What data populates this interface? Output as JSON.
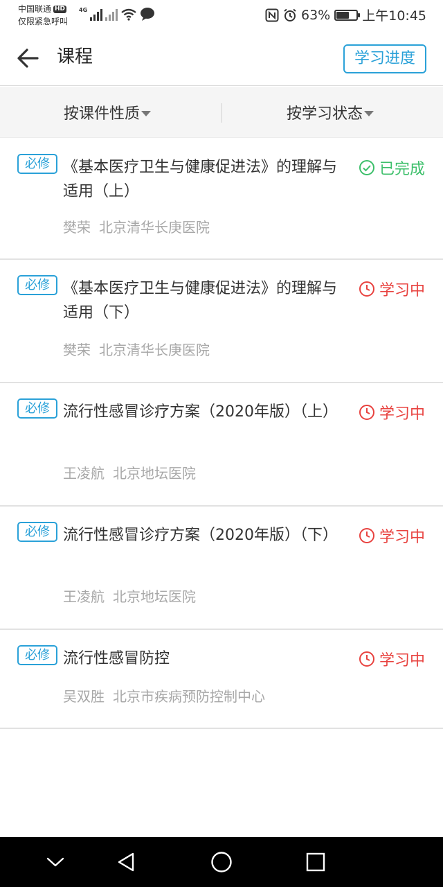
{
  "status_bar": {
    "carrier": "中国联通",
    "hd_label": "HD",
    "emergency_text": "仅限紧急呼叫",
    "network_label": "4G",
    "battery_percent": "63%",
    "battery_level": 0.63,
    "time": "上午10:45"
  },
  "header": {
    "title": "课程",
    "progress_button": "学习进度"
  },
  "filters": {
    "by_type": "按课件性质",
    "by_status": "按学习状态"
  },
  "courses": [
    {
      "badge": "必修",
      "title": "《基本医疗卫生与健康促进法》的理解与适用（上）",
      "lecturer": "樊荣",
      "institution": "北京清华长庚医院",
      "status": "已完成",
      "status_icon": "check-circle-icon"
    },
    {
      "badge": "必修",
      "title": "《基本医疗卫生与健康促进法》的理解与适用（下）",
      "lecturer": "樊荣",
      "institution": "北京清华长庚医院",
      "status": "学习中",
      "status_icon": "clock-icon"
    },
    {
      "badge": "必修",
      "title": "流行性感冒诊疗方案（2020年版）（上）",
      "lecturer": "王凌航",
      "institution": "北京地坛医院",
      "status": "学习中",
      "status_icon": "clock-icon"
    },
    {
      "badge": "必修",
      "title": "流行性感冒诊疗方案（2020年版）（下）",
      "lecturer": "王凌航",
      "institution": "北京地坛医院",
      "status": "学习中",
      "status_icon": "clock-icon"
    },
    {
      "badge": "必修",
      "title": "流行性感冒防控",
      "lecturer": "吴双胜",
      "institution": "北京市疾病预防控制中心",
      "status": "学习中",
      "status_icon": "clock-icon"
    }
  ],
  "colors": {
    "accent": "#2aa1d8",
    "done": "#3cbf6a",
    "learning": "#e8423f",
    "meta": "#a8a8a8"
  },
  "nav_bar": {
    "icons": [
      "chevron-down-icon",
      "back-triangle-icon",
      "home-circle-icon",
      "recents-square-icon"
    ]
  }
}
